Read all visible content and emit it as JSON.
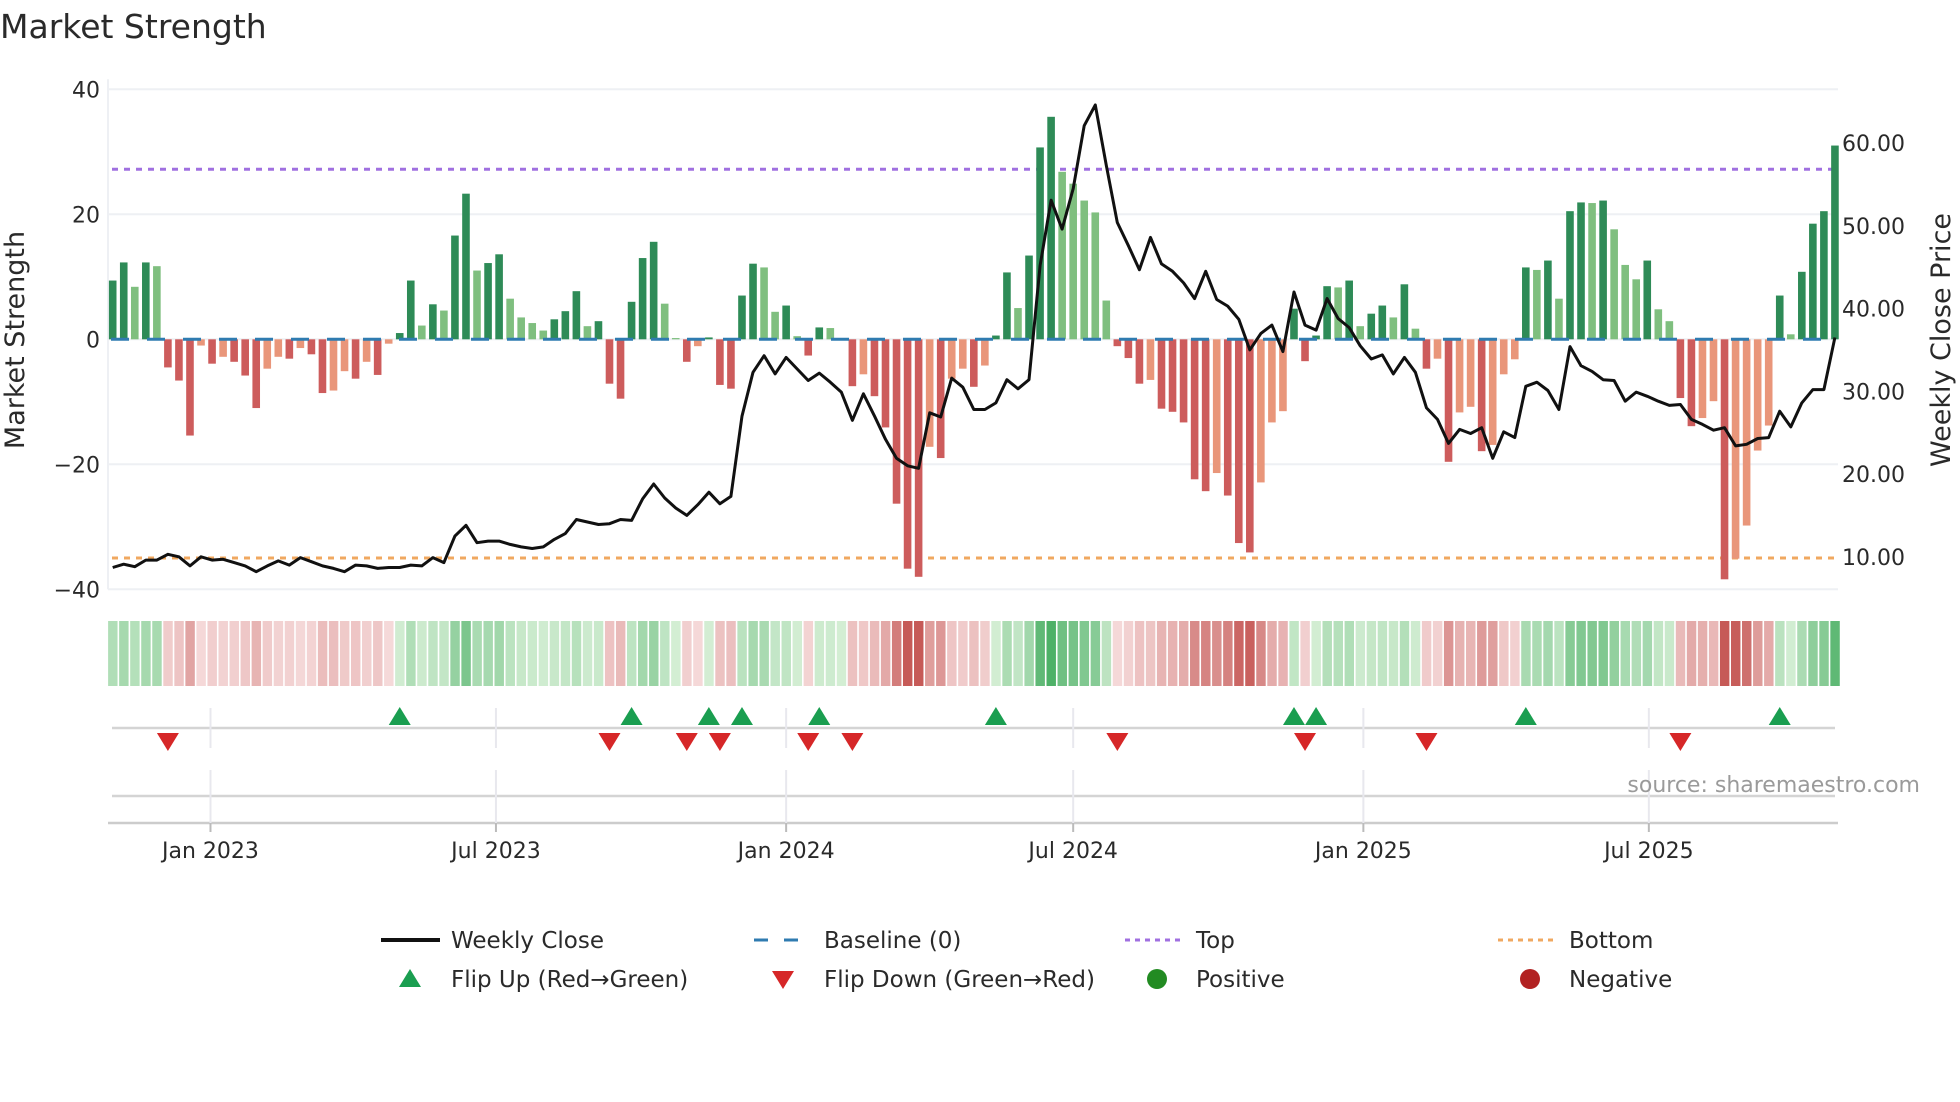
{
  "chart_data": {
    "type": "bar",
    "title": "Market Strength",
    "ylabel": "Market Strength",
    "ylabel_right": "Weekly Close Price",
    "ylim": [
      -40,
      40
    ],
    "ylim_right": [
      6.07,
      66.5
    ],
    "yticks": [
      40,
      20,
      0,
      -20,
      -40
    ],
    "yticks_labels": [
      "40",
      "20",
      "0",
      "−20",
      "−40"
    ],
    "yticks_right": [
      60,
      50,
      40,
      30,
      20,
      10
    ],
    "yticks_right_labels": [
      "60.00",
      "50.00",
      "40.00",
      "30.00",
      "20.00",
      "10.00"
    ],
    "x_start_date": "2022-10-31",
    "x_step_days": 7,
    "xticks": [
      "2023-01-01",
      "2023-07-01",
      "2024-01-01",
      "2024-07-01",
      "2025-01-01",
      "2025-07-01"
    ],
    "xtick_labels": [
      "Jan 2023",
      "Jul 2023",
      "Jan 2024",
      "Jul 2024",
      "Jan 2025",
      "Jul 2025"
    ],
    "grid": true,
    "top_level": 27.2,
    "bottom_level": -35.0,
    "strength": [
      9.4,
      12.3,
      8.4,
      12.3,
      11.7,
      -4.5,
      -6.6,
      -15.4,
      -1.0,
      -3.9,
      -2.8,
      -3.6,
      -5.8,
      -11.0,
      -4.7,
      -2.8,
      -3.1,
      -1.4,
      -2.4,
      -8.6,
      -8.2,
      -5.1,
      -6.3,
      -3.6,
      -5.7,
      -0.7,
      1.0,
      9.4,
      2.2,
      5.6,
      4.6,
      16.6,
      23.3,
      11.0,
      12.2,
      13.6,
      6.5,
      3.5,
      2.6,
      1.4,
      3.2,
      4.5,
      7.7,
      2.1,
      2.9,
      -7.1,
      -9.5,
      6.0,
      13.0,
      15.6,
      5.7,
      0.2,
      -3.6,
      -1.1,
      0.3,
      -7.3,
      -7.9,
      7.0,
      12.1,
      11.5,
      4.4,
      5.4,
      0.5,
      -2.6,
      1.9,
      1.8,
      0.2,
      -7.5,
      -5.6,
      -9.1,
      -14.1,
      -26.3,
      -36.7,
      -38.0,
      -17.2,
      -19.0,
      -6.3,
      -4.7,
      -7.6,
      -4.2,
      0.6,
      10.7,
      5.0,
      13.4,
      30.7,
      35.6,
      26.8,
      24.9,
      22.2,
      20.3,
      6.2,
      -1.1,
      -3.0,
      -7.1,
      -6.5,
      -11.1,
      -11.6,
      -13.3,
      -22.4,
      -24.3,
      -21.4,
      -25.0,
      -32.6,
      -34.1,
      -22.9,
      -13.3,
      -11.5,
      4.9,
      -3.5,
      0.6,
      8.5,
      8.3,
      9.4,
      2.1,
      4.1,
      5.4,
      3.5,
      8.8,
      1.7,
      -4.7,
      -3.1,
      -19.6,
      -11.7,
      -10.8,
      -17.9,
      -16.9,
      -5.6,
      -3.2,
      11.5,
      11.1,
      12.6,
      6.5,
      20.5,
      21.9,
      21.8,
      22.2,
      17.6,
      11.9,
      9.6,
      12.6,
      4.8,
      2.9,
      -9.4,
      -13.9,
      -12.6,
      -9.9,
      -38.4,
      -35.1,
      -29.8,
      -17.8,
      -13.8,
      7.0,
      0.8,
      10.8,
      18.5,
      20.5,
      31.0
    ],
    "weekly_close": [
      8.7,
      9.1,
      8.8,
      9.6,
      9.6,
      10.3,
      10.0,
      8.9,
      10.0,
      9.6,
      9.7,
      9.3,
      8.9,
      8.2,
      8.9,
      9.5,
      9.0,
      9.9,
      9.4,
      8.9,
      8.6,
      8.2,
      9.0,
      8.9,
      8.6,
      8.7,
      8.7,
      9.0,
      8.9,
      9.9,
      9.3,
      12.5,
      13.8,
      11.7,
      11.9,
      11.9,
      11.5,
      11.2,
      11.0,
      11.2,
      12.1,
      12.8,
      14.5,
      14.2,
      13.9,
      14.0,
      14.5,
      14.4,
      17.0,
      18.8,
      17.1,
      15.9,
      15.0,
      16.3,
      17.8,
      16.4,
      17.3,
      27.0,
      32.3,
      34.3,
      32.1,
      34.1,
      32.7,
      31.3,
      32.2,
      31.1,
      29.9,
      26.5,
      29.7,
      27.0,
      24.2,
      21.9,
      21.0,
      20.7,
      27.4,
      26.9,
      31.6,
      30.5,
      27.8,
      27.8,
      28.6,
      31.4,
      30.3,
      31.4,
      45.2,
      53.1,
      49.6,
      54.5,
      62.1,
      64.6,
      57.3,
      50.4,
      47.6,
      44.7,
      48.6,
      45.4,
      44.5,
      43.1,
      41.2,
      44.5,
      41.1,
      40.3,
      38.7,
      35.0,
      37.0,
      38.0,
      34.8,
      42.0,
      38.0,
      37.4,
      41.2,
      38.8,
      37.7,
      35.5,
      33.9,
      34.4,
      32.1,
      34.1,
      32.3,
      28.0,
      26.6,
      23.7,
      25.4,
      24.9,
      25.6,
      21.9,
      25.1,
      24.4,
      30.6,
      31.1,
      30.1,
      27.8,
      35.4,
      33.1,
      32.4,
      31.4,
      31.3,
      28.8,
      29.9,
      29.4,
      28.8,
      28.3,
      28.4,
      26.6,
      26.0,
      25.3,
      25.6,
      23.4,
      23.6,
      24.3,
      24.4,
      27.6,
      25.7,
      28.6,
      30.2,
      30.2,
      36.5
    ],
    "flip_up_weeks": [
      27,
      48,
      55,
      58,
      65,
      81,
      108,
      110,
      129,
      152
    ],
    "flip_down_weeks": [
      6,
      46,
      53,
      56,
      64,
      68,
      92,
      109,
      120,
      143
    ],
    "legend_placement": "bottom",
    "legend": [
      {
        "label": "Weekly Close",
        "symbol": "line",
        "color": "#111111"
      },
      {
        "label": "Baseline (0)",
        "symbol": "dash",
        "color": "#2f7bb0"
      },
      {
        "label": "Top",
        "symbol": "dot",
        "color": "#a070e0"
      },
      {
        "label": "Bottom",
        "symbol": "dot",
        "color": "#f0a860"
      },
      {
        "label": "Flip Up (Red→Green)",
        "symbol": "triangle-up",
        "color": "#1a9e50"
      },
      {
        "label": "Flip Down (Green→Red)",
        "symbol": "triangle-down",
        "color": "#d62728"
      },
      {
        "label": "Positive",
        "symbol": "circle",
        "color": "#228b22"
      },
      {
        "label": "Negative",
        "symbol": "circle",
        "color": "#b22222"
      }
    ],
    "colors": {
      "pos_rising": "#2e8b57",
      "pos_falling": "#7fbf7f",
      "neg_falling": "#cd5c5c",
      "neg_rising": "#e9967a",
      "close_line": "#111111",
      "baseline": "#2f7bb0",
      "top": "#a070e0",
      "bottom": "#f0a860",
      "flip_up": "#1a9e50",
      "flip_down": "#d62728"
    },
    "source": "source: sharemaestro.com"
  }
}
